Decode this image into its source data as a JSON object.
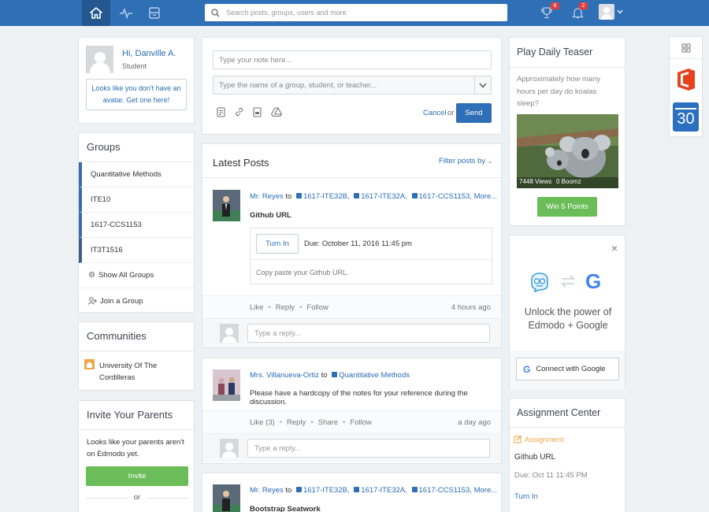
{
  "header": {
    "search_placeholder": "Search posts, groups, users and more",
    "trophy_badge": "6",
    "bell_badge": "2",
    "colors": {
      "bar": "#2f6fb5",
      "home_active": "#24578f",
      "badge": "#e43d3d"
    }
  },
  "profile": {
    "greeting": "Hi, Danville A.",
    "role": "Student",
    "avatar_prompt": "Looks like you don't have an avatar. Get one here!"
  },
  "groups": {
    "title": "Groups",
    "items": [
      "Quantitative Methods",
      "ITE10",
      "1617-CCS1153",
      "IT3T1516"
    ],
    "show_all": "Show All Groups",
    "join": "Join a Group"
  },
  "communities": {
    "title": "Communities",
    "items": [
      "University Of The Cordilleras"
    ]
  },
  "invite": {
    "title": "Invite Your Parents",
    "text": "Looks like your parents aren't on Edmodo yet.",
    "button": "Invite",
    "or": "or"
  },
  "composer": {
    "note_placeholder": "Type your note here...",
    "to_placeholder": "Type the name of a group, student, or teacher...",
    "cancel": "Cancel",
    "or": "or",
    "send": "Send"
  },
  "feed": {
    "title": "Latest Posts",
    "filter": "Filter posts by",
    "reply_placeholder": "Type a reply...",
    "posts": [
      {
        "author": "Mr. Reyes",
        "to": "to",
        "groups": [
          "1617-ITE32B,",
          "1617-ITE32A,",
          "1617-CCS1153,"
        ],
        "more": "More...",
        "title": "Github URL",
        "turn_in": "Turn In",
        "due": "Due: October 11, 2016 11:45 pm",
        "assignment_text": "Copy paste your Github URL.",
        "actions": [
          "Like",
          "Reply",
          "Follow"
        ],
        "time": "4 hours ago"
      },
      {
        "author": "Mrs. Villanueva-Ortiz",
        "to": "to",
        "groups": [
          "Quantitative Methods"
        ],
        "text": "Please have a hardcopy of the notes for your reference during the discussion.",
        "actions": [
          "Like (3)",
          "Reply",
          "Share",
          "Follow"
        ],
        "time": "a day ago"
      },
      {
        "author": "Mr. Reyes",
        "to": "to",
        "groups": [
          "1617-ITE32B,",
          "1617-ITE32A,",
          "1617-CCS1153,"
        ],
        "more": "More...",
        "title": "Bootstrap Seatwork"
      }
    ]
  },
  "teaser": {
    "title": "Play Daily Teaser",
    "question": "Approximately how many hours per day do koalas sleep?",
    "views": "7448 Views",
    "boomz": "0 Boomz",
    "button": "Win 5 Points"
  },
  "google_promo": {
    "close": "×",
    "text": "Unlock the power of Edmodo + Google",
    "connect": "Connect with Google"
  },
  "assignment_center": {
    "title": "Assignment Center",
    "type": "Assignment",
    "name": "Github URL",
    "due": "Due: Oct 11 11:45 PM",
    "action": "Turn In"
  },
  "apps": {
    "calendar_day": "30"
  }
}
